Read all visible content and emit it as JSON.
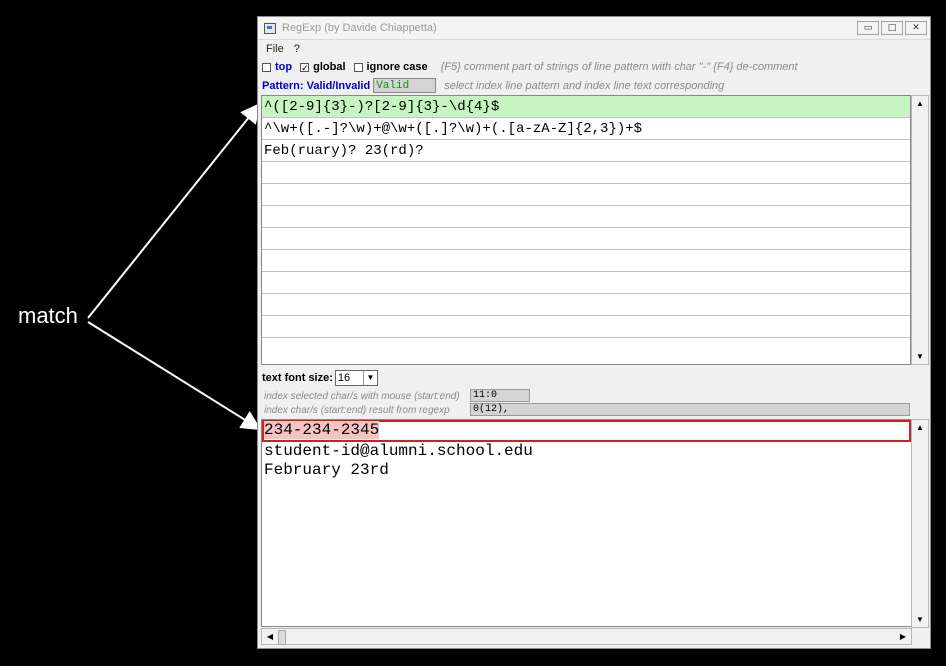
{
  "annotation": {
    "label": "match"
  },
  "window": {
    "title": "RegExp (by Davide Chiappetta)",
    "controls": {
      "minimize": "▭",
      "maximize": "□",
      "close": "✕"
    }
  },
  "menu": [
    "File",
    "?"
  ],
  "options": {
    "top": {
      "label": "top",
      "checked": false
    },
    "global": {
      "label": "global",
      "checked": true,
      "mark": "✓"
    },
    "ignore_case": {
      "label": "ignore case",
      "checked": false
    },
    "hint": "{F5} comment part of strings of line pattern with char \"-\" {F4} de-comment"
  },
  "pattern": {
    "label": "Pattern: Valid/Invalid",
    "status": "Valid",
    "hint": "select index line pattern and index line text  corresponding"
  },
  "patterns": [
    "^([2-9]{3}-)?[2-9]{3}-\\d{4}$",
    "^\\w+([.-]?\\w)+@\\w+([.]?\\w)+(.[a-zA-Z]{2,3})+$",
    "Feb(ruary)? 23(rd)?"
  ],
  "font": {
    "label": "text font size:",
    "size": "16"
  },
  "index": {
    "selected_label": "index selected char/s with mouse (start:end)",
    "selected_value": "11:0",
    "result_label": "index char/s (start:end) result from regexp",
    "result_value": "0(12),"
  },
  "text_lines": {
    "first": "234-234-2345",
    "second": "student-id@alumni.school.edu",
    "third": "February 23rd"
  },
  "scroll": {
    "up": "▲",
    "down": "▼",
    "left": "◀",
    "right": "▶"
  }
}
